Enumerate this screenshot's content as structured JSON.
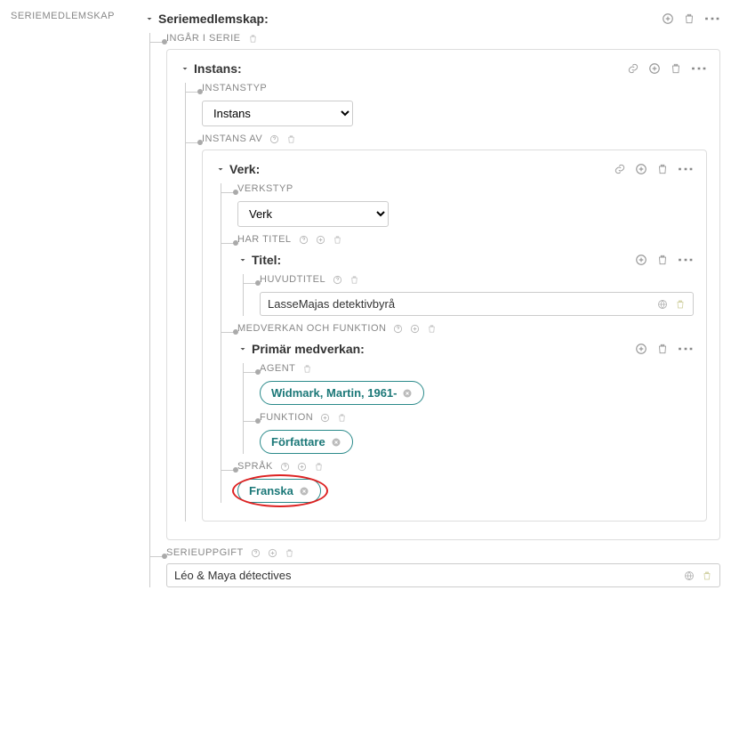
{
  "leftLabel": "SERIEMEDLEMSKAP",
  "seriemedlemskap": {
    "title": "Seriemedlemskap:"
  },
  "ingarISerie": {
    "label": "INGÅR I SERIE"
  },
  "instans": {
    "title": "Instans:",
    "instanstyp": {
      "label": "INSTANSTYP",
      "value": "Instans"
    },
    "instansAv": {
      "label": "INSTANS AV"
    }
  },
  "verk": {
    "title": "Verk:",
    "verkstyp": {
      "label": "VERKSTYP",
      "value": "Verk"
    },
    "harTitel": {
      "label": "HAR TITEL"
    },
    "titel": {
      "title": "Titel:",
      "huvudtitel": {
        "label": "HUVUDTITEL",
        "value": "LasseMajas detektivbyrå"
      }
    },
    "medverkan": {
      "label": "MEDVERKAN OCH FUNKTION",
      "primar": {
        "title": "Primär medverkan:",
        "agent": {
          "label": "AGENT",
          "value": "Widmark, Martin, 1961-"
        },
        "funktion": {
          "label": "FUNKTION",
          "value": "Författare"
        }
      }
    },
    "sprak": {
      "label": "SPRÅK",
      "value": "Franska"
    }
  },
  "serieuppgift": {
    "label": "SERIEUPPGIFT",
    "value": "Léo & Maya détectives"
  }
}
